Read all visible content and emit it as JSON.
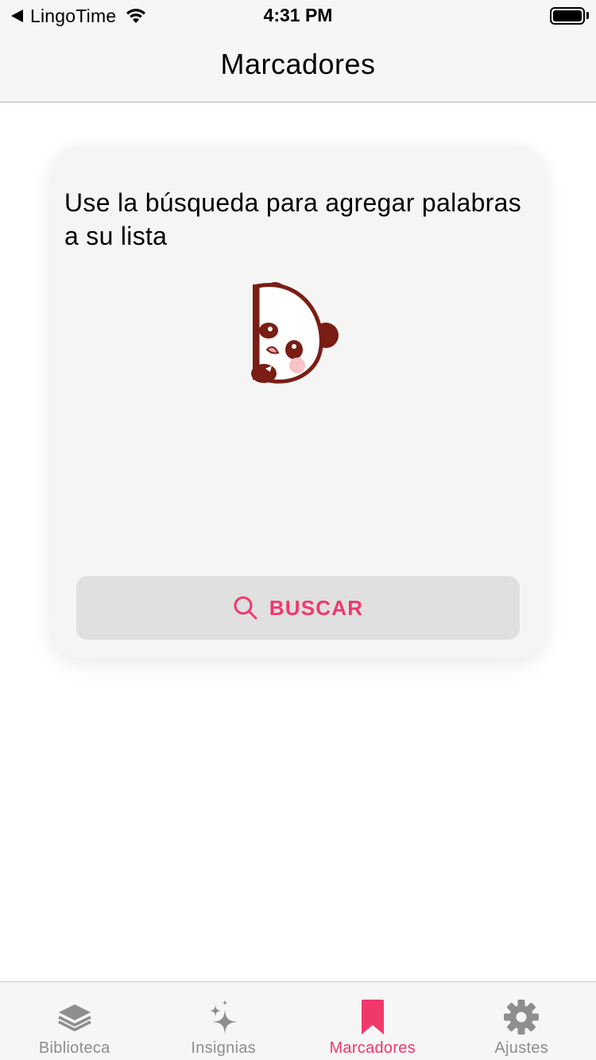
{
  "status_bar": {
    "back_app": "LingoTime",
    "time": "4:31 PM",
    "icons": [
      "back-arrow-icon",
      "wifi-icon",
      "battery-icon"
    ]
  },
  "nav": {
    "title": "Marcadores"
  },
  "empty_state": {
    "message": "Use la búsqueda para agregar palabras a su lista",
    "illustration": "panda-peeking-icon"
  },
  "search_button": {
    "label": "BUSCAR",
    "icon": "search-icon"
  },
  "tabs": [
    {
      "label": "Biblioteca",
      "icon": "layers-icon",
      "active": false
    },
    {
      "label": "Insignias",
      "icon": "sparkles-icon",
      "active": false
    },
    {
      "label": "Marcadores",
      "icon": "bookmark-icon",
      "active": true
    },
    {
      "label": "Ajustes",
      "icon": "gear-icon",
      "active": false
    }
  ],
  "colors": {
    "accent": "#f0386b",
    "inactive": "#8e8e8e",
    "bar_background": "#f6f6f6",
    "card_background": "#f5f5f5",
    "button_background": "#e0e0e0",
    "panda_brown": "#7a1d14"
  }
}
